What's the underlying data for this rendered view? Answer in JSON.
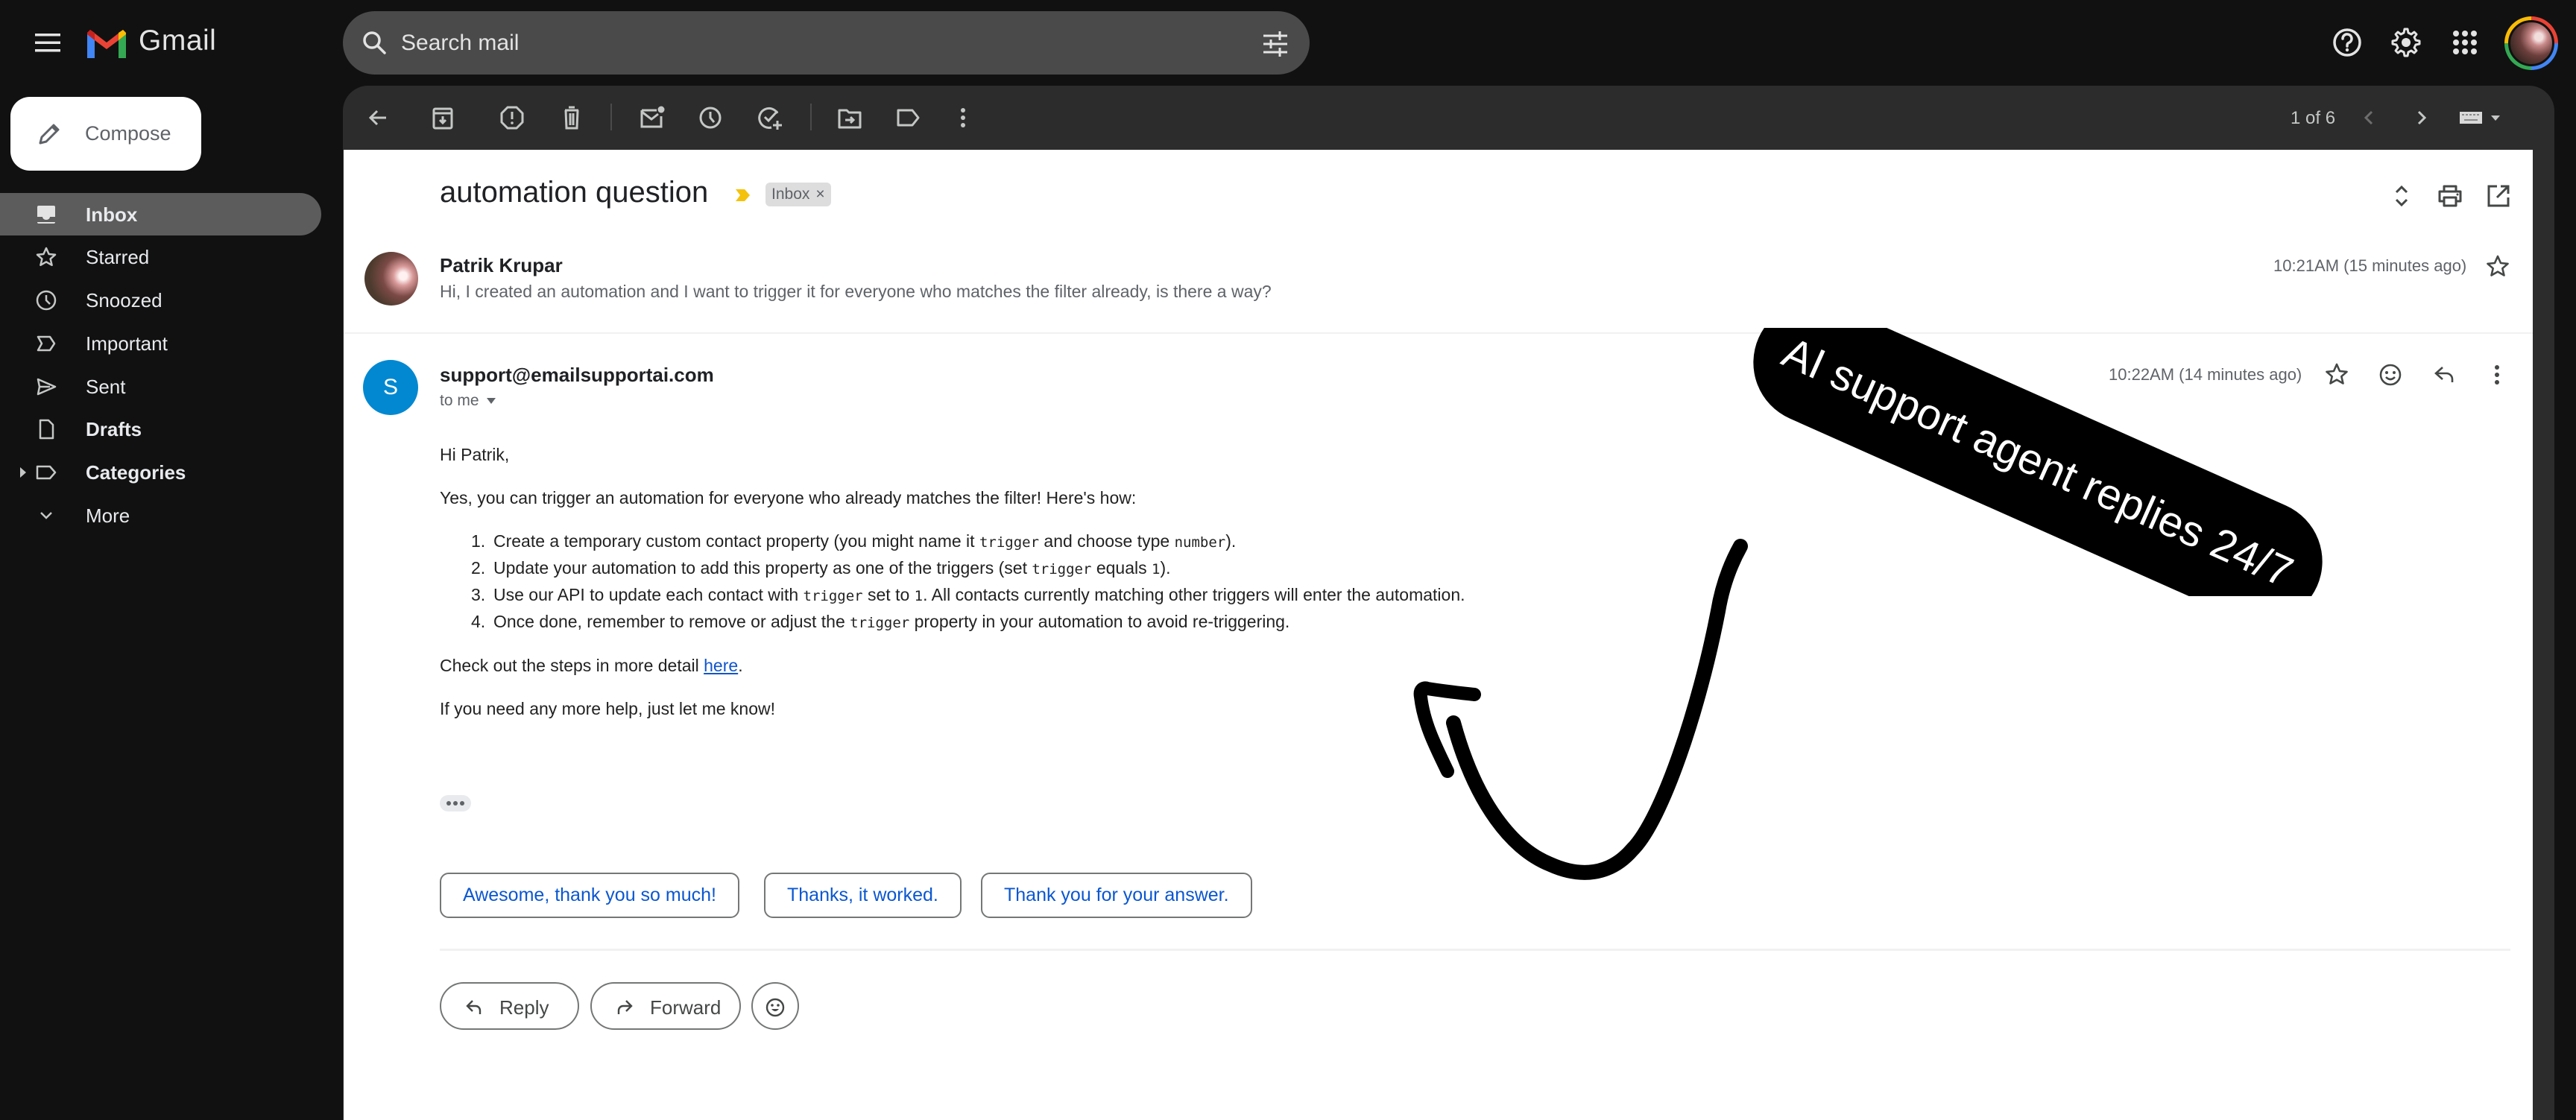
{
  "app": {
    "name": "Gmail",
    "brand_colors": {
      "red": "#ea4335",
      "blue": "#4285f4",
      "green": "#34a853",
      "yellow": "#fbbc04"
    }
  },
  "search": {
    "placeholder": "Search mail",
    "value": ""
  },
  "top_icons": [
    "help-icon",
    "settings-gear-icon",
    "apps-grid-icon",
    "account-avatar"
  ],
  "compose": {
    "label": "Compose"
  },
  "sidebar": {
    "items": [
      {
        "label": "Inbox",
        "icon": "inbox-icon",
        "active": true,
        "bold": true
      },
      {
        "label": "Starred",
        "icon": "star-icon",
        "active": false,
        "bold": false
      },
      {
        "label": "Snoozed",
        "icon": "clock-icon",
        "active": false,
        "bold": false
      },
      {
        "label": "Important",
        "icon": "important-icon",
        "active": false,
        "bold": false
      },
      {
        "label": "Sent",
        "icon": "send-icon",
        "active": false,
        "bold": false
      },
      {
        "label": "Drafts",
        "icon": "draft-icon",
        "active": false,
        "bold": true
      },
      {
        "label": "Categories",
        "icon": "label-icon",
        "active": false,
        "bold": true,
        "expandable": true
      },
      {
        "label": "More",
        "icon": "chevron-down-icon",
        "active": false,
        "bold": false
      }
    ]
  },
  "toolbar": {
    "actions": [
      "back",
      "archive",
      "report-spam",
      "delete",
      "mark-unread",
      "snooze",
      "add-to-tasks",
      "move-to",
      "labels",
      "more"
    ],
    "pager": "1 of 6"
  },
  "thread": {
    "subject": "automation question",
    "label_chip": "Inbox",
    "label_chip_remove": "×",
    "messages": [
      {
        "sender": "Patrik Krupar",
        "snippet": "Hi, I created an automation and I want to trigger it for everyone who matches the filter already, is there a way?",
        "time": "10:21AM (15 minutes ago)"
      },
      {
        "sender": "support@emailsupportai.com",
        "avatar_letter": "S",
        "avatar_color": "#0288d1",
        "to": "to me",
        "time": "10:22AM (14 minutes ago)",
        "greeting": "Hi Patrik,",
        "intro": "Yes, you can trigger an automation for everyone who already matches the filter! Here's how:",
        "steps": [
          {
            "num": "1.",
            "parts": [
              "Create a temporary custom contact property (you might name it ",
              "trigger",
              " and choose type ",
              "number",
              ")."
            ]
          },
          {
            "num": "2.",
            "parts": [
              "Update your automation to add this property as one of the triggers (set ",
              "trigger",
              " equals ",
              "1",
              ")."
            ]
          },
          {
            "num": "3.",
            "parts": [
              "Use our API to update each contact with ",
              "trigger",
              " set to ",
              "1",
              ". All contacts currently matching other triggers will enter the automation."
            ]
          },
          {
            "num": "4.",
            "parts": [
              "Once done, remember to remove or adjust the ",
              "trigger",
              " property in your automation to avoid re-triggering.",
              "",
              ""
            ]
          }
        ],
        "detail_prefix": "Check out the steps in more detail ",
        "detail_link": "here",
        "detail_suffix": ".",
        "closing": "If you need any more help, just let me know!"
      }
    ]
  },
  "smart_replies": [
    "Awesome, thank you so much!",
    "Thanks, it worked.",
    "Thank you for your answer."
  ],
  "actions": {
    "reply": "Reply",
    "forward": "Forward"
  },
  "annotation": {
    "text": "AI support agent replies 24/7"
  }
}
